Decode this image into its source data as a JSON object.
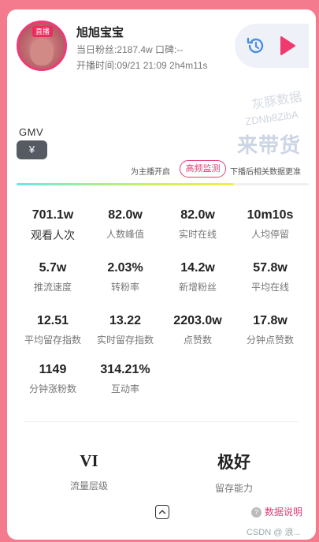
{
  "streamer": {
    "badge": "直播",
    "name": "旭旭宝宝",
    "fans_line": "当日粉丝:2187.4w   口碑:--",
    "start_line": "开播时间:09/21 21:09   2h4m11s"
  },
  "gmv": {
    "label": "GMV",
    "button": "¥"
  },
  "watermark": {
    "line1": "灰豚数据",
    "line2": "ZDNb8ZibA",
    "line3": "来带货"
  },
  "notice": {
    "left": "为主播开启",
    "tag": "高频监测",
    "right": "下播后相关数据更准"
  },
  "metrics": [
    {
      "value": "701.1w",
      "label": "观看人次"
    },
    {
      "value": "82.0w",
      "label": "人数峰值"
    },
    {
      "value": "82.0w",
      "label": "实时在线"
    },
    {
      "value": "10m10s",
      "label": "人均停留"
    },
    {
      "value": "5.7w",
      "label": "推流速度"
    },
    {
      "value": "2.03%",
      "label": "转粉率"
    },
    {
      "value": "14.2w",
      "label": "新增粉丝"
    },
    {
      "value": "57.8w",
      "label": "平均在线"
    },
    {
      "value": "12.51",
      "label": "平均留存指数"
    },
    {
      "value": "13.22",
      "label": "实时留存指数"
    },
    {
      "value": "2203.0w",
      "label": "点赞数"
    },
    {
      "value": "17.8w",
      "label": "分钟点赞数"
    },
    {
      "value": "1149",
      "label": "分钟涨粉数"
    },
    {
      "value": "314.21%",
      "label": "互动率"
    }
  ],
  "summary": [
    {
      "value": "VI",
      "label": "流量层级"
    },
    {
      "value": "极好",
      "label": "留存能力"
    }
  ],
  "footer": {
    "explain": "数据说明",
    "credit": "CSDN @ 浪..."
  },
  "colors": {
    "accent": "#e23c78",
    "background": "#f47a8d"
  }
}
